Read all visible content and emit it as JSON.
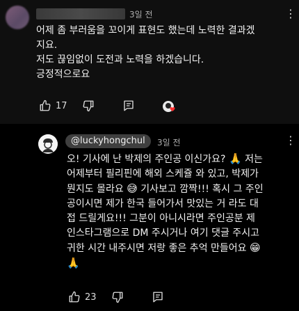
{
  "comment": {
    "time": "3일 전",
    "text": "어제 좀 부러움을 꼬이게 표현도 했는데 노력한 결과겠\n지요.\n저도 끊임없이 도전과 노력을 하겠습니다.\n긍정적으로요",
    "likes": "17"
  },
  "reply": {
    "handle": "@luckyhongchul",
    "time": "3일 전",
    "line1": "오! 기사에 난 박제의 주인공 이신가요?",
    "emoji1": "🙏",
    "line1b": "저는",
    "line2": "어제부터 필리핀에 해외 스케쥴 와 있고, 박제가",
    "line3": "뭔지도 몰라요",
    "emoji2": "😅",
    "line3b": "기사보고 깜짝!!! 혹시 그 주인",
    "line4": "공이시면 제가 한국 들어가서 맛있는 거 라도 대",
    "line5": "접 드릴게요!!! 그분이 아니시라면 주인공분 제",
    "line6": "인스타그램으로 DM 주시거나 여기 댓글 주시고",
    "line7": "귀한 시간 내주시면 저랑 좋은 추억 만들어요",
    "emoji3": "😁",
    "emoji4": "🙏",
    "likes": "23"
  },
  "icons": {
    "like": "thumbs-up-icon",
    "dislike": "thumbs-down-icon",
    "reply": "reply-icon",
    "more": "more-vertical-icon",
    "heart": "creator-heart-icon"
  }
}
